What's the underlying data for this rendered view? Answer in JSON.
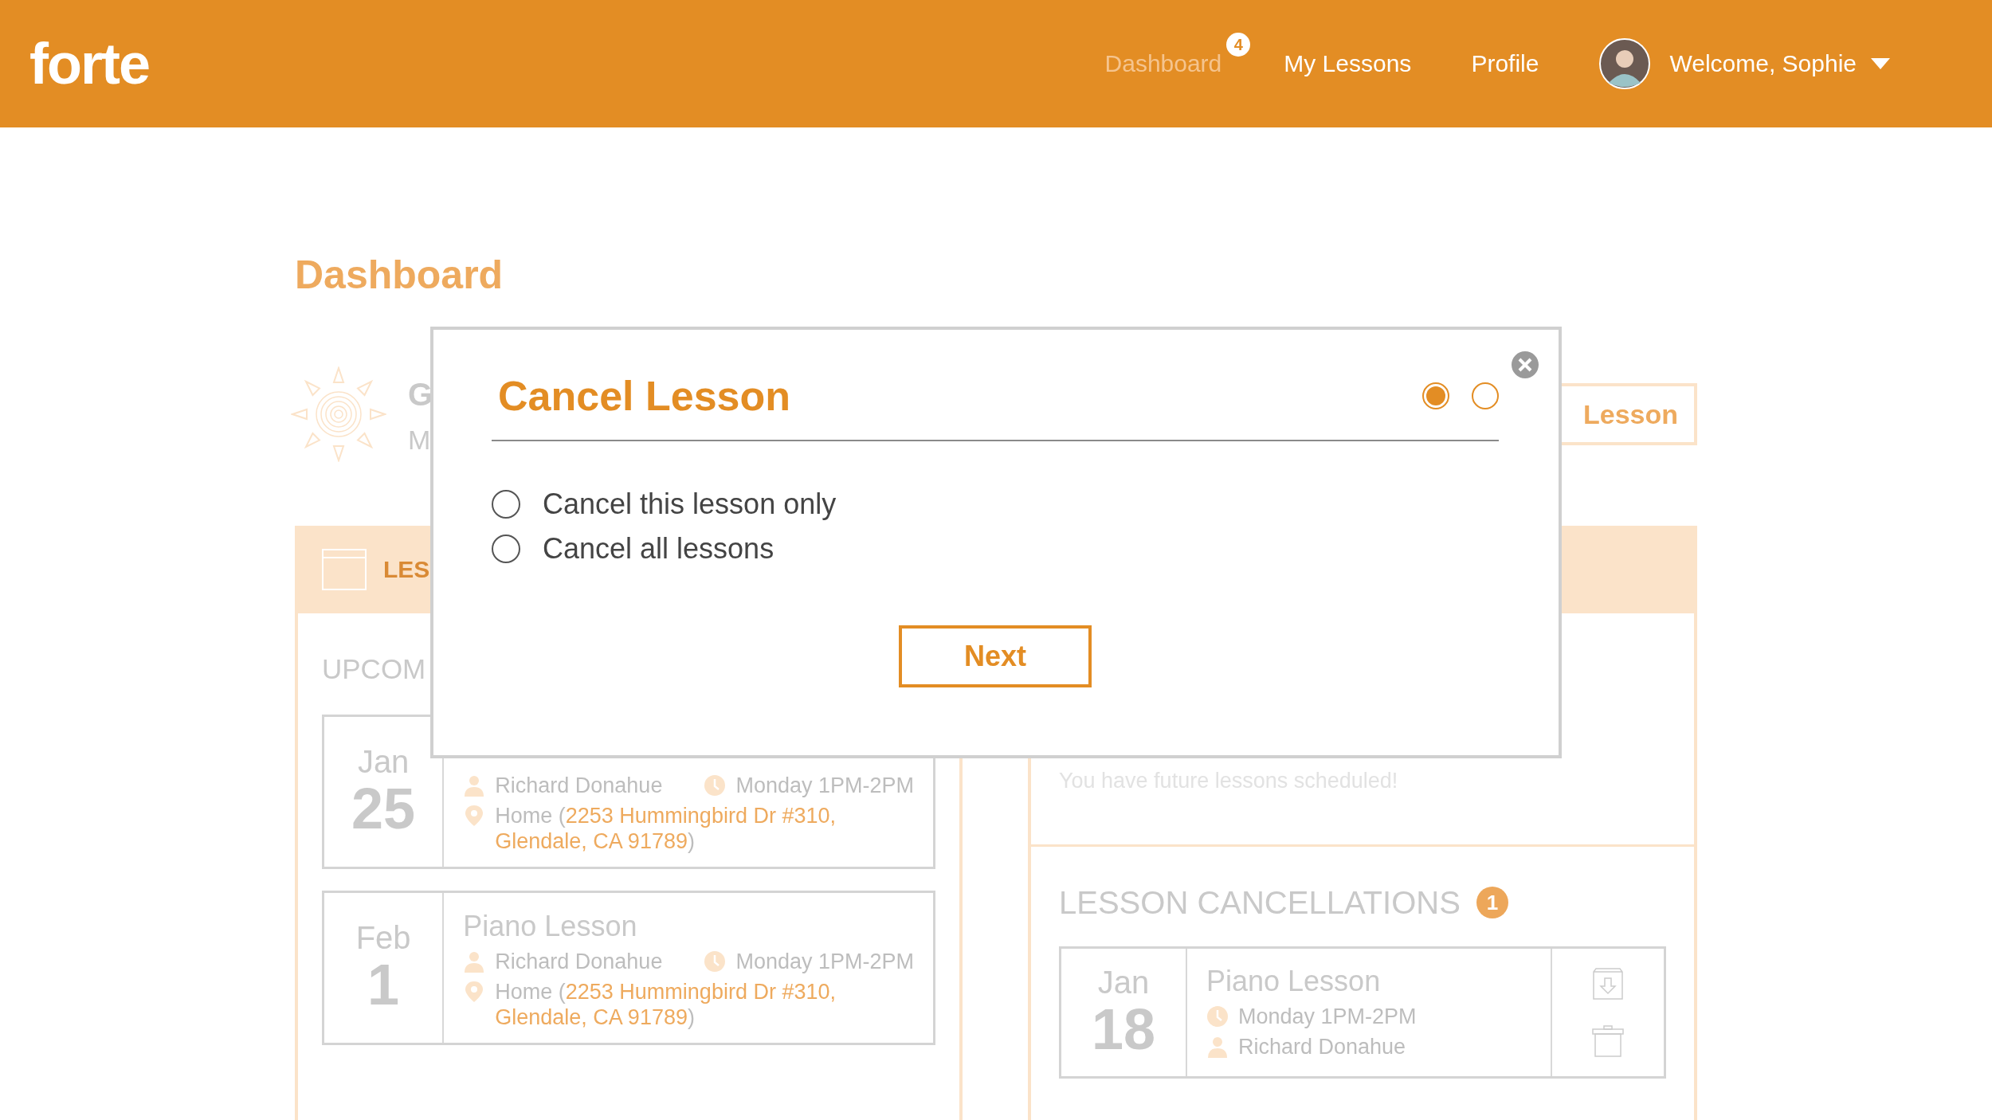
{
  "header": {
    "logo": "forte",
    "nav": [
      {
        "label": "Dashboard",
        "selected": true,
        "badge": "4"
      },
      {
        "label": "My Lessons",
        "selected": false
      },
      {
        "label": "Profile",
        "selected": false
      }
    ],
    "user": {
      "label": "Welcome, Sophie"
    }
  },
  "page": {
    "title": "Dashboard",
    "greeting": "G",
    "greeting_sub": "M",
    "new_lesson_button": "Lesson",
    "panel_title": "LES",
    "upcoming": {
      "title": "UPCOM",
      "lessons": [
        {
          "month": "Jan",
          "day": "25",
          "teacher": "Richard Donahue",
          "time": "Monday 1PM-2PM",
          "location": "Home (*2253 Hummingbird Dr #310, Glendale, CA 91789*)"
        },
        {
          "month": "Feb",
          "day": "1",
          "title": "Piano Lesson",
          "teacher": "Richard Donahue",
          "time": "Monday 1PM-2PM",
          "location": "Home (*2253 Hummingbird Dr #310, Glendale, CA 91789*)"
        }
      ]
    },
    "message": "You have future lessons scheduled!",
    "cancellations": {
      "title": "LESSON CANCELLATIONS",
      "count": "1",
      "lessons": [
        {
          "month": "Jan",
          "day": "18",
          "title": "Piano Lesson",
          "time": "Monday 1PM-2PM",
          "teacher": "Richard Donahue"
        }
      ]
    }
  },
  "modal": {
    "title": "Cancel Lesson",
    "steps": [
      {
        "selected": true
      },
      {
        "selected": false
      }
    ],
    "options": [
      {
        "label": "Cancel this lesson only",
        "selected": false
      },
      {
        "label": "Cancel all lessons",
        "selected": false
      }
    ],
    "button": "Next"
  }
}
